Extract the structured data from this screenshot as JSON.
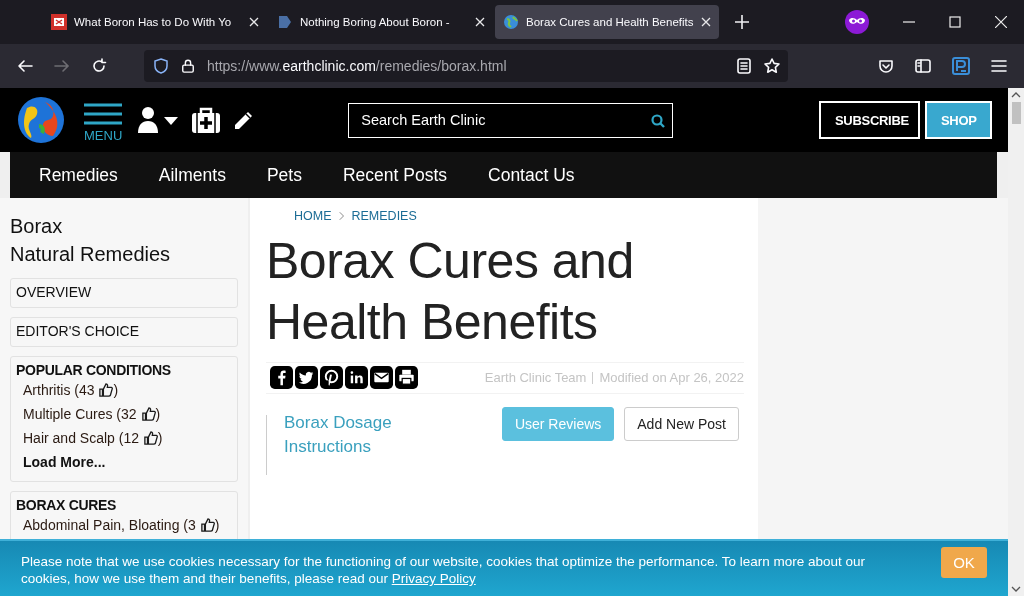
{
  "browser": {
    "tabs": [
      {
        "title": "What Boron Has to Do With Yo",
        "selected": false
      },
      {
        "title": "Nothing Boring About Boron -",
        "selected": false
      },
      {
        "title": "Borax Cures and Health Benefits",
        "selected": true
      }
    ],
    "url": {
      "prefix": "https://www.",
      "domain": "earthclinic.com",
      "path": "/remedies/borax.html"
    },
    "forward_disabled": true
  },
  "header": {
    "menu_label": "MENU",
    "search": {
      "placeholder": "Search Earth Clinic"
    },
    "buttons": [
      {
        "label": "SUBSCRIBE",
        "kind": "outline"
      },
      {
        "label": "SHOP",
        "kind": "filled"
      }
    ]
  },
  "nav": [
    "Remedies",
    "Ailments",
    "Pets",
    "Recent Posts",
    "Contact Us"
  ],
  "sidebar": {
    "title": "Borax",
    "subtitle": "Natural Remedies",
    "sections": [
      {
        "heading": "OVERVIEW",
        "kind": "link"
      },
      {
        "heading": "EDITOR'S CHOICE",
        "kind": "link"
      },
      {
        "heading": "POPULAR CONDITIONS",
        "kind": "list",
        "items": [
          {
            "before": "Arthritis (43",
            "after": ")"
          },
          {
            "before": "Multiple Cures (32",
            "after": ")"
          },
          {
            "before": "Hair and Scalp (12",
            "after": ")"
          }
        ],
        "more": "Load More..."
      },
      {
        "heading": "BORAX CURES",
        "kind": "list",
        "items": [
          {
            "before": "Abdominal Pain, Bloating (3",
            "after": ")"
          }
        ]
      }
    ]
  },
  "article": {
    "breadcrumb": [
      "HOME",
      "REMEDIES"
    ],
    "title": "Borax Cures and Health Benefits",
    "author": "Earth Clinic Team",
    "modified": "Modified on Apr 26, 2022",
    "toc": [
      "Borax Dosage",
      "Instructions"
    ],
    "buttons": [
      {
        "label": "User Reviews",
        "kind": "filled"
      },
      {
        "label": "Add New Post",
        "kind": "outline"
      }
    ]
  },
  "cookie_banner": {
    "text": "Please note that we use cookies necessary for the functioning of our website, cookies that optimize the performance. To learn more about our cookies, how we use them and their benefits, please read our",
    "link": "Privacy Policy",
    "button": "OK"
  }
}
